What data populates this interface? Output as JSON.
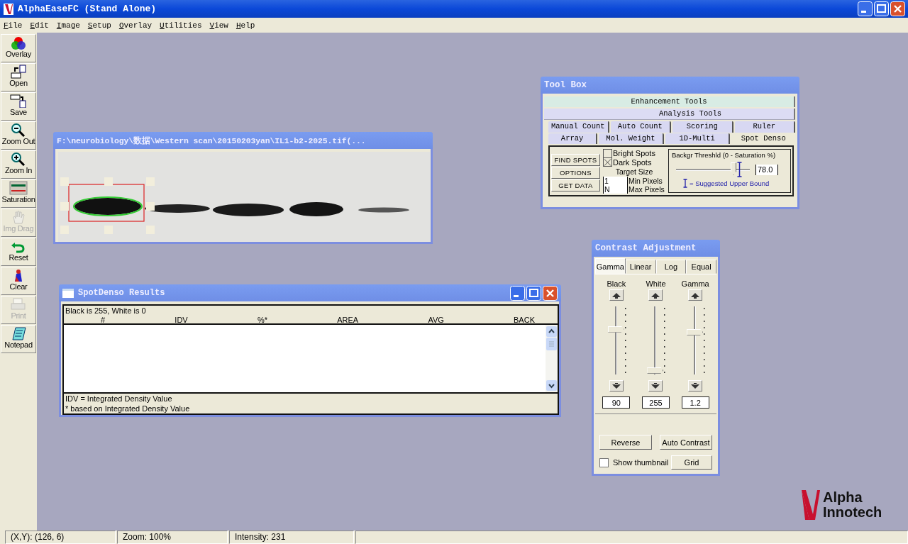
{
  "window": {
    "title": "AlphaEaseFC (Stand Alone)"
  },
  "menu": [
    "File",
    "Edit",
    "Image",
    "Setup",
    "Overlay",
    "Utilities",
    "View",
    "Help"
  ],
  "toolbar": [
    {
      "label": "Overlay",
      "disabled": false
    },
    {
      "label": "Open",
      "disabled": false
    },
    {
      "label": "Save",
      "disabled": false
    },
    {
      "label": "Zoom Out",
      "disabled": false
    },
    {
      "label": "Zoom In",
      "disabled": false
    },
    {
      "label": "Saturation",
      "disabled": false
    },
    {
      "label": "Img Drag",
      "disabled": true
    },
    {
      "label": "Reset",
      "disabled": false
    },
    {
      "label": "Clear",
      "disabled": false
    },
    {
      "label": "Print",
      "disabled": true
    },
    {
      "label": "Notepad",
      "disabled": false
    }
  ],
  "image_window": {
    "title": "F:\\neurobiology\\数据\\Western scan\\20150203yan\\IL1-b2-2025.tif(..."
  },
  "results_window": {
    "title": "SpotDenso Results",
    "note": "Black is 255, White is 0",
    "columns": [
      "#",
      "IDV",
      "%*",
      "AREA",
      "AVG",
      "BACK"
    ],
    "footer": [
      "IDV = Integrated Density Value",
      "* based on Integrated Density Value"
    ]
  },
  "toolbox": {
    "title": "Tool Box",
    "groups": [
      {
        "label": "Enhancement Tools",
        "selected": false
      },
      {
        "label": "Analysis Tools",
        "selected": true
      }
    ],
    "tab_rows": [
      [
        {
          "label": "Manual Count",
          "selected": false
        },
        {
          "label": "Auto Count",
          "selected": false
        },
        {
          "label": "Scoring",
          "selected": false
        },
        {
          "label": "Ruler",
          "selected": false
        }
      ],
      [
        {
          "label": "Array",
          "selected": false
        },
        {
          "label": "Mol. Weight",
          "selected": false
        },
        {
          "label": "1D-Multi",
          "selected": false
        },
        {
          "label": "Spot Denso",
          "selected": true
        }
      ]
    ],
    "buttons": [
      "FIND SPOTS",
      "OPTIONS",
      "GET DATA"
    ],
    "checkboxes": [
      {
        "label": "Bright Spots",
        "checked": false
      },
      {
        "label": "Dark Spots",
        "checked": true
      }
    ],
    "target_size": {
      "label": "Target Size",
      "fields": [
        {
          "value": "1",
          "label": "Min Pixels"
        },
        {
          "value": "N",
          "label": "Max Pixels"
        }
      ]
    },
    "threshold": {
      "label": "Backgr Threshld (0 - Saturation %)",
      "level": 0.78,
      "value": "78.0",
      "legend": "= Suggested Upper Bound"
    }
  },
  "contrast": {
    "title": "Contrast Adjustment",
    "tabs": [
      {
        "label": "Gamma",
        "selected": true
      },
      {
        "label": "Linear",
        "selected": false
      },
      {
        "label": "Log",
        "selected": false
      },
      {
        "label": "Equal",
        "selected": false
      }
    ],
    "sliders": [
      {
        "label": "Black",
        "level": 0.62,
        "value": "90"
      },
      {
        "label": "White",
        "level": 0.06,
        "value": "255"
      },
      {
        "label": "Gamma",
        "level": 0.58,
        "value": "1.2"
      }
    ],
    "buttons": [
      "Reverse",
      "Auto Contrast"
    ],
    "show_thumbnail": {
      "label": "Show thumbnail",
      "checked": false
    },
    "grid_button": "Grid"
  },
  "logo": {
    "lines": [
      "Alpha",
      "Innotech"
    ]
  },
  "status_bar": [
    "(X,Y): (126, 6)",
    "Zoom: 100%",
    "Intensity: 231"
  ]
}
